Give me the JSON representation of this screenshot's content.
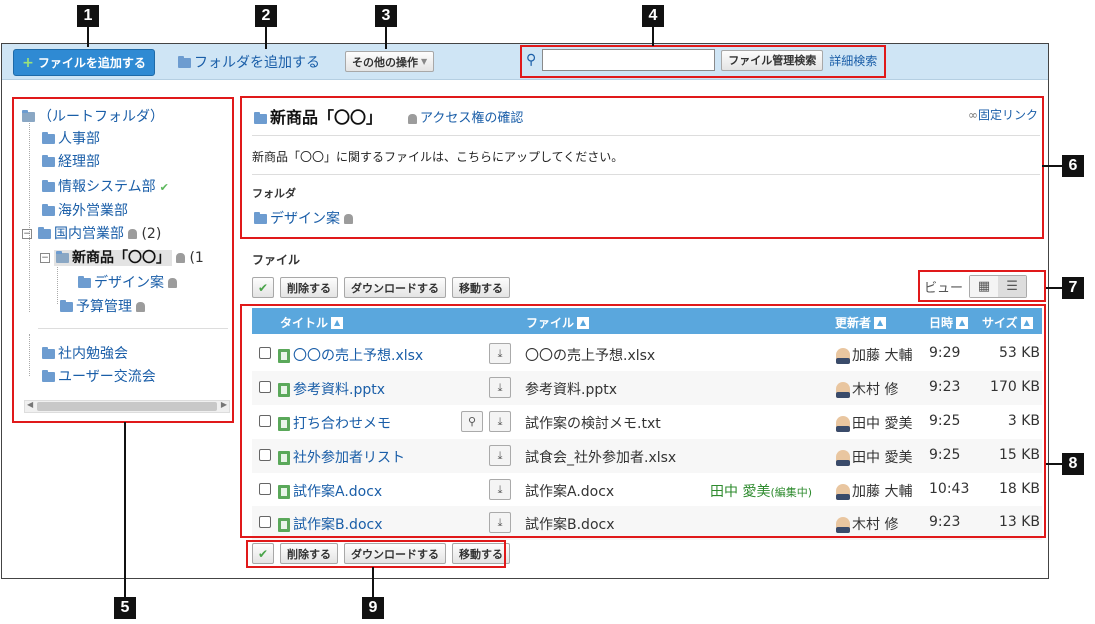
{
  "callouts": [
    "1",
    "2",
    "3",
    "4",
    "5",
    "6",
    "7",
    "8",
    "9"
  ],
  "toolbar": {
    "add_file": "ファイルを追加する",
    "add_folder": "フォルダを追加する",
    "other_ops": "その他の操作",
    "search_placeholder": "",
    "search_button": "ファイル管理検索",
    "detail_search": "詳細検索"
  },
  "tree": {
    "root": "（ルートフォルダ）",
    "items": [
      "人事部",
      "経理部",
      "情報システム部",
      "海外営業部",
      "国内営業部",
      "新商品「〇〇」",
      "デザイン案",
      "予算管理",
      "社内勉強会",
      "ユーザー交流会"
    ],
    "domestic_count": "(2)",
    "new_product_count": "(1"
  },
  "folder": {
    "title": "新商品「〇〇」",
    "access_link": "アクセス権の確認",
    "permalink": "固定リンク",
    "description": "新商品「〇〇」に関するファイルは、こちらにアップしてください。",
    "subfolder_label": "フォルダ",
    "subfolder": "デザイン案"
  },
  "files": {
    "label": "ファイル",
    "actions": {
      "delete": "削除する",
      "download": "ダウンロードする",
      "move": "移動する"
    },
    "view_label": "ビュー",
    "columns": {
      "title": "タイトル",
      "file": "ファイル",
      "updater": "更新者",
      "time": "日時",
      "size": "サイズ"
    },
    "rows": [
      {
        "title": "〇〇の売上予想.xlsx",
        "file": "〇〇の売上予想.xlsx",
        "editing": "",
        "editing_tag": "",
        "updater": "加藤 大輔",
        "time": "9:29",
        "size": "53 KB"
      },
      {
        "title": "参考資料.pptx",
        "file": "参考資料.pptx",
        "editing": "",
        "editing_tag": "",
        "updater": "木村 修",
        "time": "9:23",
        "size": "170 KB"
      },
      {
        "title": "打ち合わせメモ",
        "file": "試作案の検討メモ.txt",
        "editing": "",
        "editing_tag": "",
        "updater": "田中 愛美",
        "time": "9:25",
        "size": "3 KB"
      },
      {
        "title": "社外参加者リスト",
        "file": "試食会_社外参加者.xlsx",
        "editing": "",
        "editing_tag": "",
        "updater": "田中 愛美",
        "time": "9:25",
        "size": "15 KB"
      },
      {
        "title": "試作案A.docx",
        "file": "試作案A.docx",
        "editing": "田中 愛美",
        "editing_tag": "(編集中)",
        "updater": "加藤 大輔",
        "time": "10:43",
        "size": "18 KB"
      },
      {
        "title": "試作案B.docx",
        "file": "試作案B.docx",
        "editing": "",
        "editing_tag": "",
        "updater": "木村 修",
        "time": "9:23",
        "size": "13 KB"
      }
    ]
  }
}
